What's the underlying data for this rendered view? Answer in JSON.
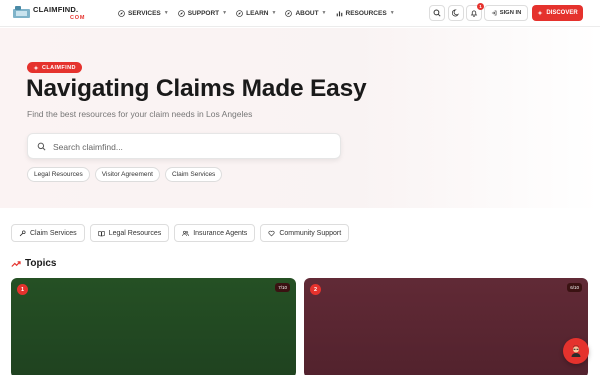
{
  "header": {
    "logo_main": "CLAIMFIND.",
    "logo_sub": "COM",
    "nav": [
      {
        "label": "SERVICES",
        "icon": "compass-icon"
      },
      {
        "label": "SUPPORT",
        "icon": "compass-icon"
      },
      {
        "label": "LEARN",
        "icon": "compass-icon"
      },
      {
        "label": "ABOUT",
        "icon": "compass-icon"
      },
      {
        "label": "RESOURCES",
        "icon": "bar-chart-icon"
      }
    ],
    "notification_count": "1",
    "signin_label": "SIGN IN",
    "discover_label": "DISCOVER"
  },
  "hero": {
    "badge": "CLAIMFIND",
    "title": "Navigating Claims Made Easy",
    "subtitle": "Find the best resources for your claim needs in Los Angeles",
    "search_placeholder": "Search claimfind...",
    "chips": [
      "Legal Resources",
      "Visitor Agreement",
      "Claim Services"
    ]
  },
  "categories": [
    {
      "label": "Claim Services",
      "icon": "wrench-icon"
    },
    {
      "label": "Legal Resources",
      "icon": "book-icon"
    },
    {
      "label": "Insurance Agents",
      "icon": "users-icon"
    },
    {
      "label": "Community Support",
      "icon": "heart-icon"
    }
  ],
  "topics": {
    "heading": "Topics",
    "cards": [
      {
        "number": "1",
        "score": "7/10",
        "color": "#255024"
      },
      {
        "number": "2",
        "score": "6/10",
        "color": "#612a36"
      }
    ]
  },
  "colors": {
    "accent": "#e5322d"
  }
}
